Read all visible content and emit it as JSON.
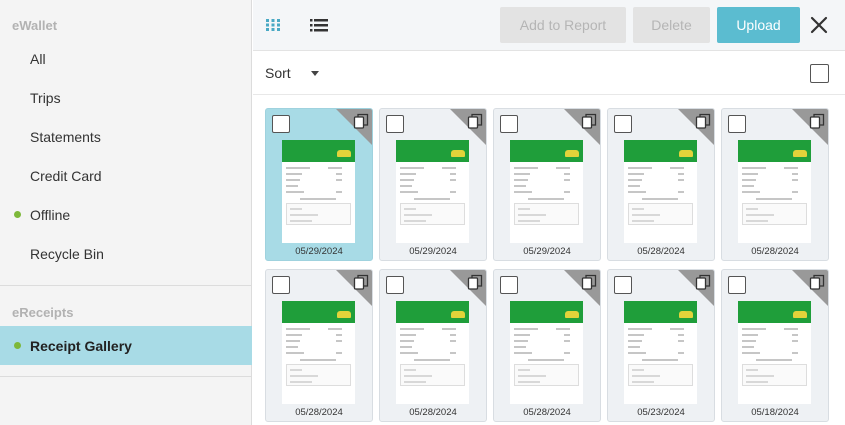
{
  "sidebar": {
    "ewallet_header": "eWallet",
    "ewallet_items": [
      {
        "label": "All",
        "dot": false
      },
      {
        "label": "Trips",
        "dot": false
      },
      {
        "label": "Statements",
        "dot": false
      },
      {
        "label": "Credit Card",
        "dot": false
      },
      {
        "label": "Offline",
        "dot": true
      },
      {
        "label": "Recycle Bin",
        "dot": false
      }
    ],
    "ereceipts_header": "eReceipts",
    "ereceipts_items": [
      {
        "label": "Receipt Gallery",
        "dot": true,
        "active": true
      }
    ],
    "dot_color": "#7db83a",
    "active_color": "#a8dbe6"
  },
  "toolbar": {
    "grid_view_icon": "grid-view-icon",
    "list_view_icon": "list-view-icon",
    "add_to_report_label": "Add to Report",
    "delete_label": "Delete",
    "upload_label": "Upload",
    "close_icon": "close-icon",
    "accent_color": "#5bbcd0"
  },
  "sortbar": {
    "sort_label": "Sort"
  },
  "receipts": [
    {
      "date": "05/29/2024",
      "selected": true
    },
    {
      "date": "05/29/2024",
      "selected": false
    },
    {
      "date": "05/29/2024",
      "selected": false
    },
    {
      "date": "05/28/2024",
      "selected": false
    },
    {
      "date": "05/28/2024",
      "selected": false
    },
    {
      "date": "05/28/2024",
      "selected": false
    },
    {
      "date": "05/28/2024",
      "selected": false
    },
    {
      "date": "05/28/2024",
      "selected": false
    },
    {
      "date": "05/23/2024",
      "selected": false
    },
    {
      "date": "05/18/2024",
      "selected": false
    }
  ]
}
